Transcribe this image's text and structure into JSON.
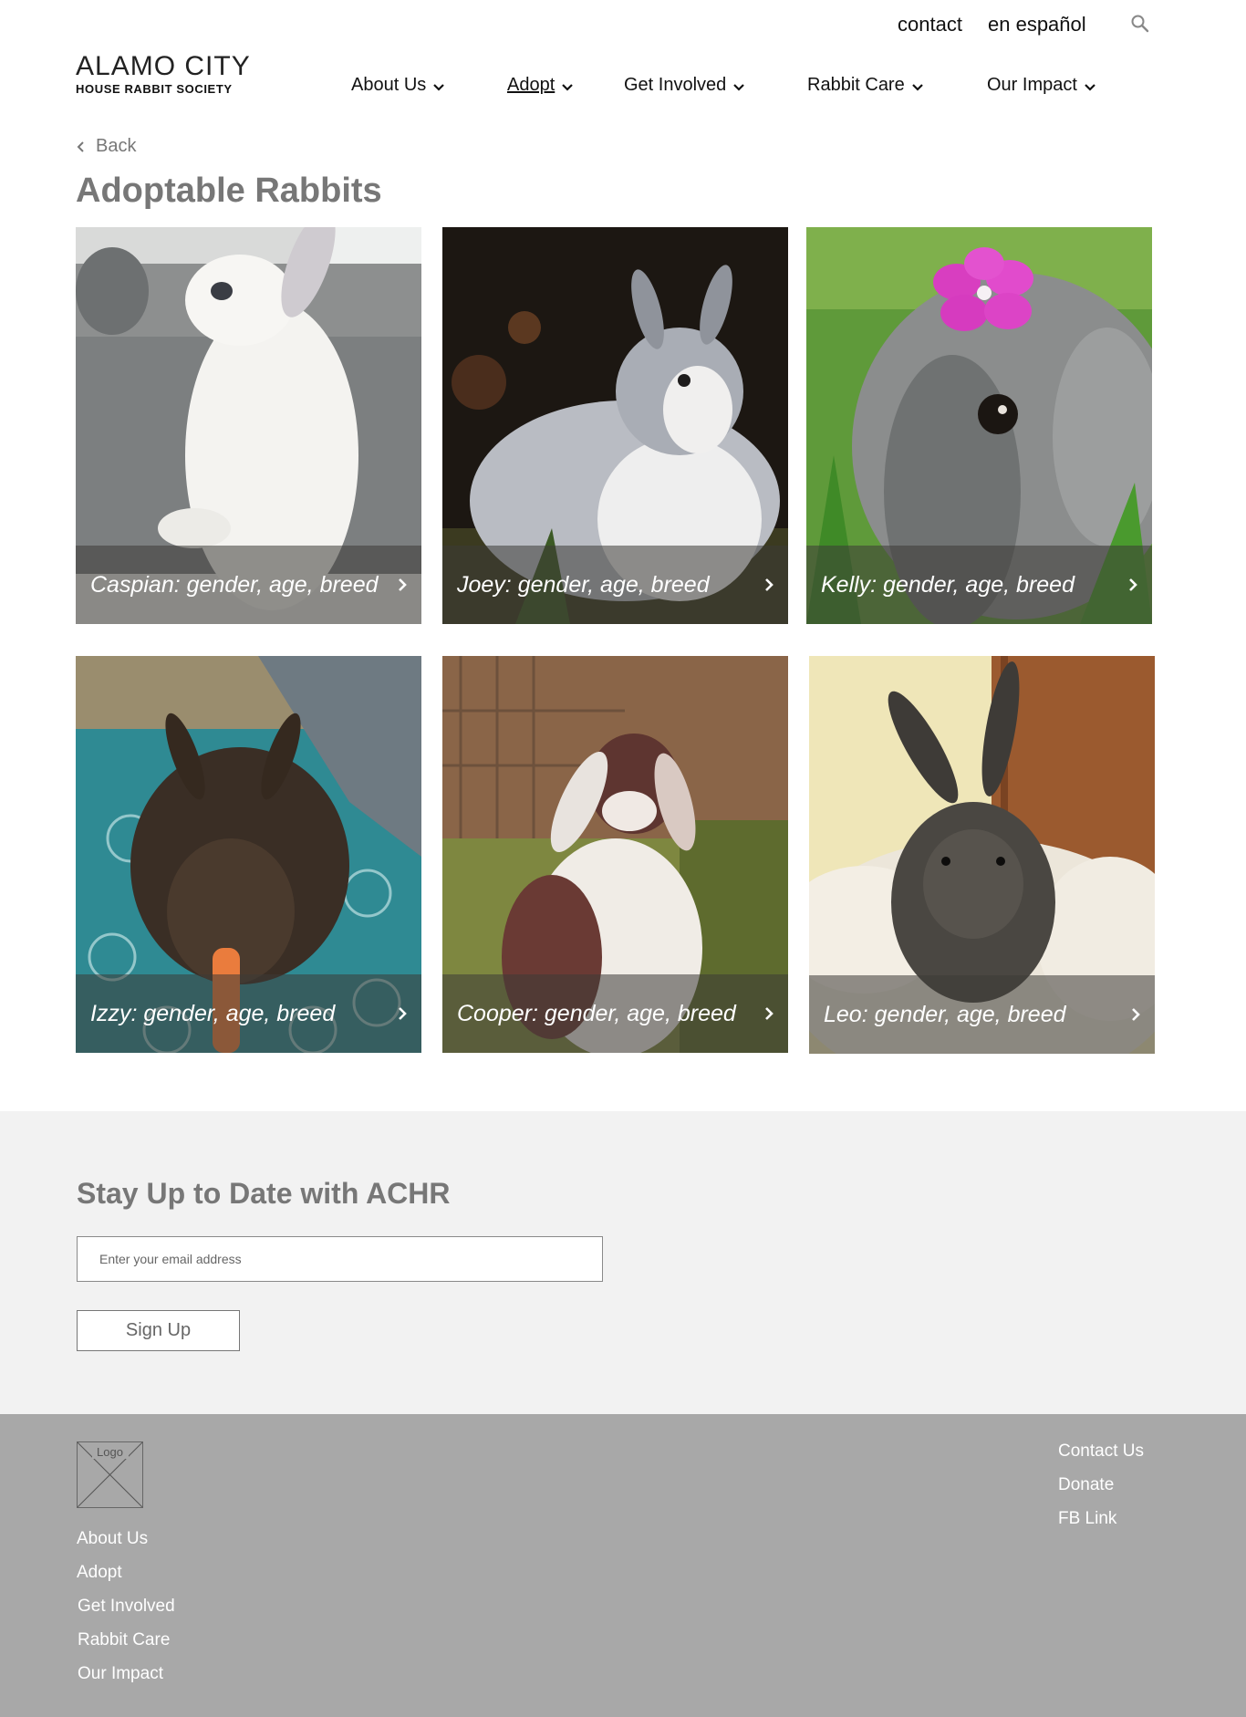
{
  "utility_nav": {
    "contact": "contact",
    "espanol": "en español",
    "search_icon": "search-icon"
  },
  "logo": {
    "line1": "ALAMO CITY",
    "line2": "HOUSE RABBIT SOCIETY"
  },
  "main_nav": {
    "items": [
      {
        "label": "About Us",
        "icon": "chevron-down-icon"
      },
      {
        "label": "Adopt",
        "icon": "chevron-down-icon",
        "active": true
      },
      {
        "label": "Get Involved",
        "icon": "chevron-down-icon"
      },
      {
        "label": "Rabbit Care",
        "icon": "chevron-down-icon"
      },
      {
        "label": "Our Impact",
        "icon": "chevron-down-icon"
      }
    ]
  },
  "back": {
    "label": "Back",
    "icon": "chevron-left-icon"
  },
  "page_title": "Adoptable Rabbits",
  "rabbits": [
    {
      "caption": "Caspian: gender, age, breed",
      "icon": "chevron-right-icon"
    },
    {
      "caption": "Joey: gender, age, breed",
      "icon": "chevron-right-icon"
    },
    {
      "caption": "Kelly: gender, age, breed",
      "icon": "chevron-right-icon"
    },
    {
      "caption": "Izzy: gender, age, breed",
      "icon": "chevron-right-icon"
    },
    {
      "caption": "Cooper: gender, age, breed",
      "icon": "chevron-right-icon"
    },
    {
      "caption": "Leo: gender, age, breed",
      "icon": "chevron-right-icon"
    }
  ],
  "newsletter": {
    "title": "Stay Up to Date with ACHR",
    "email_placeholder": "Enter your email address",
    "email_value": "",
    "signup_label": "Sign Up"
  },
  "footer": {
    "logo_label": "Logo",
    "left_links": [
      "About Us",
      "Adopt",
      "Get Involved",
      "Rabbit Care",
      "Our Impact"
    ],
    "right_links": [
      "Contact Us",
      "Donate",
      "FB Link"
    ]
  },
  "colors": {
    "page_bg": "#ffffff",
    "title_gray": "#777777",
    "newsletter_bg": "#f2f2f2",
    "footer_bg": "#a8a8a8",
    "caption_overlay": "rgba(60,58,55,0.55)"
  }
}
